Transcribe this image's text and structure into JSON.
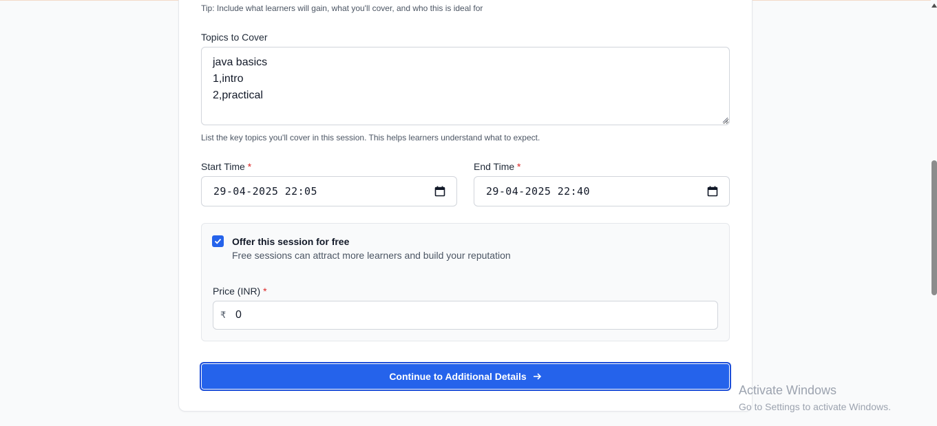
{
  "form": {
    "tip": "Tip: Include what learners will gain, what you'll cover, and who this is ideal for",
    "topics": {
      "label": "Topics to Cover",
      "value": "java basics\n1,intro\n2,practical",
      "help": "List the key topics you'll cover in this session. This helps learners understand what to expect."
    },
    "start_time": {
      "label": "Start Time",
      "required_mark": "*",
      "value": "29-04-2025 22:05"
    },
    "end_time": {
      "label": "End Time",
      "required_mark": "*",
      "value": "29-04-2025 22:40"
    },
    "free_offer": {
      "checked": true,
      "title": "Offer this session for free",
      "description": "Free sessions can attract more learners and build your reputation"
    },
    "price": {
      "label": "Price (INR)",
      "required_mark": "*",
      "currency_symbol": "₹",
      "value": "0"
    },
    "continue_label": "Continue to Additional Details"
  },
  "watermark": {
    "title": "Activate Windows",
    "subtitle": "Go to Settings to activate Windows."
  },
  "icons": {
    "calendar": "calendar-icon",
    "arrow": "arrow-right-icon",
    "check": "check-icon"
  },
  "colors": {
    "accent": "#2563eb",
    "required": "#dc2626"
  }
}
